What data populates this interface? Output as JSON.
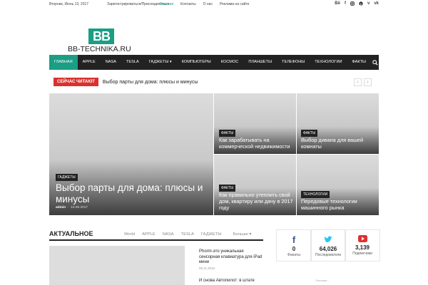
{
  "topbar": {
    "date": "Вторник, Июнь 13, 2017",
    "auth": "Зарегистрироваться/Присоединиться",
    "menu": [
      "Главная",
      "Контакты",
      "О нас",
      "Реклама на сайте"
    ],
    "social": [
      "Bē",
      "f",
      "ig",
      "p",
      "v",
      "vk"
    ]
  },
  "logo": {
    "mark": "BB",
    "text": "BB-TECHNIKA.RU"
  },
  "nav": {
    "items": [
      "ГЛАВНАЯ",
      "APPLE",
      "NASA",
      "TESLA",
      "ГАДЖЕТЫ",
      "КОМПЬЮТЕРЫ",
      "КОСМОС",
      "ПЛАНШЕТЫ",
      "ТЕЛЕФОНЫ",
      "ТЕХНОЛОГИИ",
      "ФАКТЫ"
    ],
    "dropdown_marker": "▾"
  },
  "ticker": {
    "label": "СЕЙЧАС ЧИТАЮТ",
    "text": "Выбор парты для дома: плюсы и минусы",
    "prev": "‹",
    "next": "›"
  },
  "featured": {
    "big": {
      "category": "ГАДЖЕТЫ",
      "title": "Выбор парты для дома: плюсы и минусы",
      "author": "admin",
      "date": "10.06.2017"
    },
    "tiles": [
      {
        "category": "ФАКТЫ",
        "title": "Как зарабатывать на коммерческой недвижимости"
      },
      {
        "category": "ФАКТЫ",
        "title": "Выбор дивана для вашей комнаты"
      },
      {
        "category": "ФАКТЫ",
        "title": "Как правильно утеплить свой дом, квартиру или дачу в 2017 году"
      },
      {
        "category": "ТЕХНОЛОГИИ",
        "title": "Передовые технологии машинного рынка"
      }
    ]
  },
  "actual": {
    "heading": "АКТУАЛЬНОЕ",
    "tabs": [
      "World",
      "APPLE",
      "NASA",
      "TESLA",
      "ГАДЖЕТЫ",
      "Больше ▾"
    ],
    "posts": [
      {
        "title": "Phorm-это уникальная сенсорная клавиатура для iPad мини",
        "date": "09.11.2016"
      },
      {
        "title": "И снова Автопилот: в штате"
      }
    ]
  },
  "social_counters": [
    {
      "network": "facebook",
      "count": "0",
      "label": "Фанаты",
      "color": "#3b5998"
    },
    {
      "network": "twitter",
      "count": "64,026",
      "label": "Последователи",
      "color": "#29c5f6"
    },
    {
      "network": "youtube",
      "count": "3,139",
      "label": "Подписчики",
      "color": "#e02f2f"
    }
  ],
  "ad_label": "- Реклама -",
  "colors": {
    "accent": "#1a9e84",
    "nav_bg": "#222222",
    "ticker_red": "#d9322e"
  }
}
